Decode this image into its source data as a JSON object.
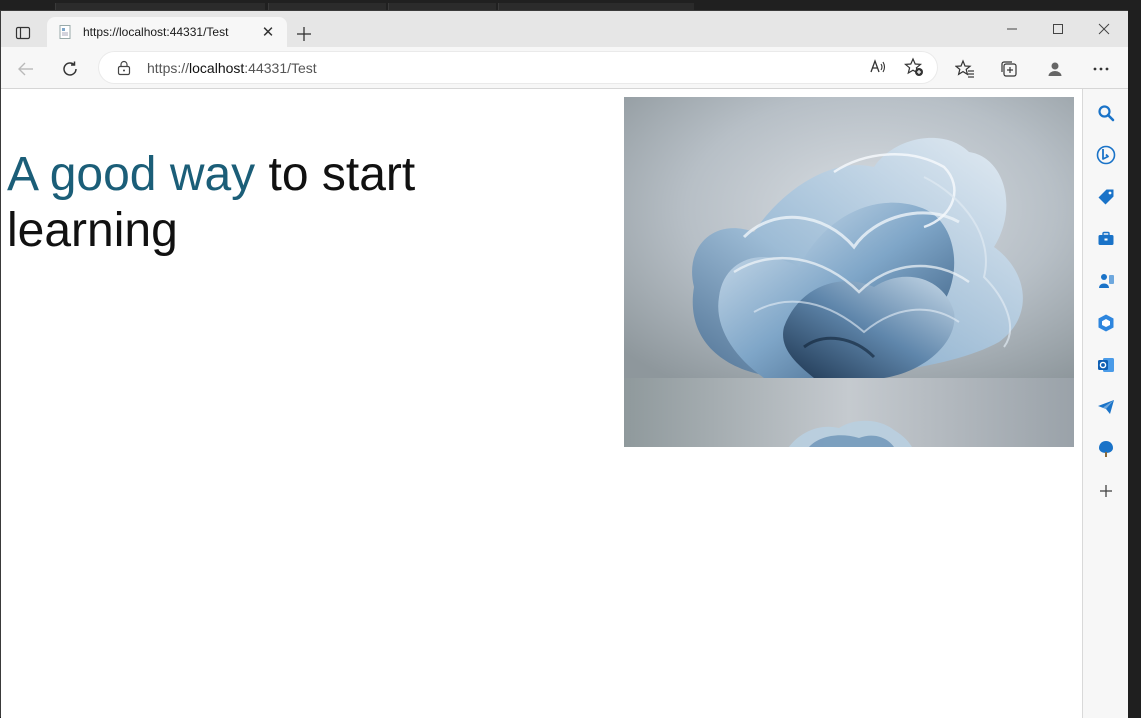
{
  "tab": {
    "title": "https://localhost:44331/Test"
  },
  "address": {
    "scheme": "https://",
    "host": "localhost",
    "rest": ":44331/Test"
  },
  "page": {
    "headline_accent": "A good way",
    "headline_rest": " to start learning"
  },
  "colors": {
    "accent": "#1b5e78",
    "edge_blue": "#1a73c8"
  },
  "sidebar": {
    "icons": [
      "search-icon",
      "bing-icon",
      "shopping-tag-icon",
      "tools-briefcase-icon",
      "games-icon",
      "office-icon",
      "outlook-icon",
      "send-telegram-icon",
      "drop-tree-icon",
      "add-icon"
    ]
  }
}
